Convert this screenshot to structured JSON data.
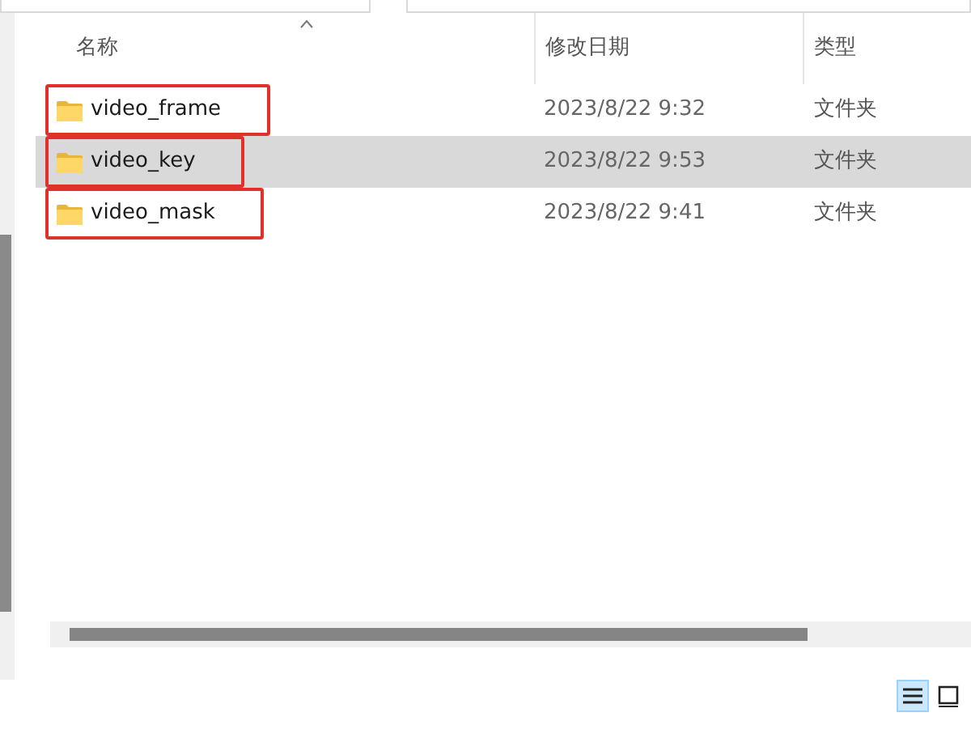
{
  "columns": [
    {
      "label": "名称",
      "sorted": true
    },
    {
      "label": "修改日期",
      "sorted": false
    },
    {
      "label": "类型",
      "sorted": false
    }
  ],
  "rows": [
    {
      "name": "video_frame",
      "modified": "2023/8/22 9:32",
      "type": "文件夹",
      "selected": false,
      "annotated": true
    },
    {
      "name": "video_key",
      "modified": "2023/8/22 9:53",
      "type": "文件夹",
      "selected": true,
      "annotated": true
    },
    {
      "name": "video_mask",
      "modified": "2023/8/22 9:41",
      "type": "文件夹",
      "selected": false,
      "annotated": true
    }
  ],
  "view_buttons": [
    {
      "kind": "details",
      "selected": true
    },
    {
      "kind": "tiles",
      "selected": false
    }
  ]
}
